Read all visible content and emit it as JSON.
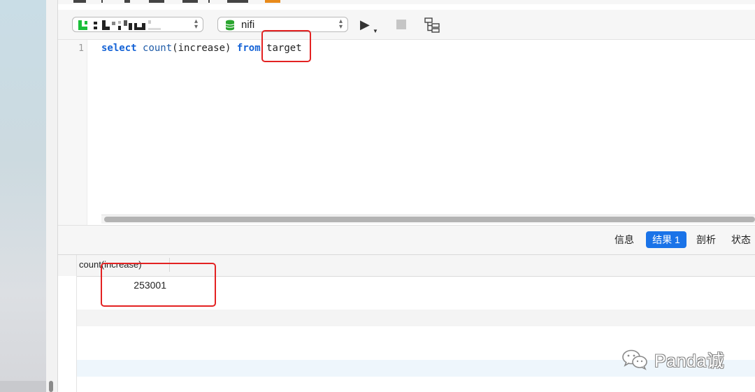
{
  "toolbar": {
    "connection_value": "",
    "database_value": "nifi",
    "run_icon": "play-icon",
    "stop_icon": "stop-icon",
    "explain_icon": "explain-plan-icon"
  },
  "editor": {
    "line_number": "1",
    "query": {
      "kw_select": "select",
      "fn_count": "count",
      "arg": "(increase)",
      "kw_from": "from",
      "table": "target"
    }
  },
  "result_tabs": [
    {
      "label": "信息",
      "active": false
    },
    {
      "label": "结果 1",
      "active": true
    },
    {
      "label": "剖析",
      "active": false
    },
    {
      "label": "状态",
      "active": false
    }
  ],
  "grid": {
    "columns": [
      "count(increase)"
    ],
    "rows": [
      [
        "253001"
      ]
    ]
  },
  "watermark": {
    "text": "Panda诚",
    "icon": "wechat-icon"
  },
  "colors": {
    "accent": "#1a73e8",
    "highlight": "#e32222",
    "keyword": "#1563d6",
    "db_icon": "#2aa52f"
  }
}
